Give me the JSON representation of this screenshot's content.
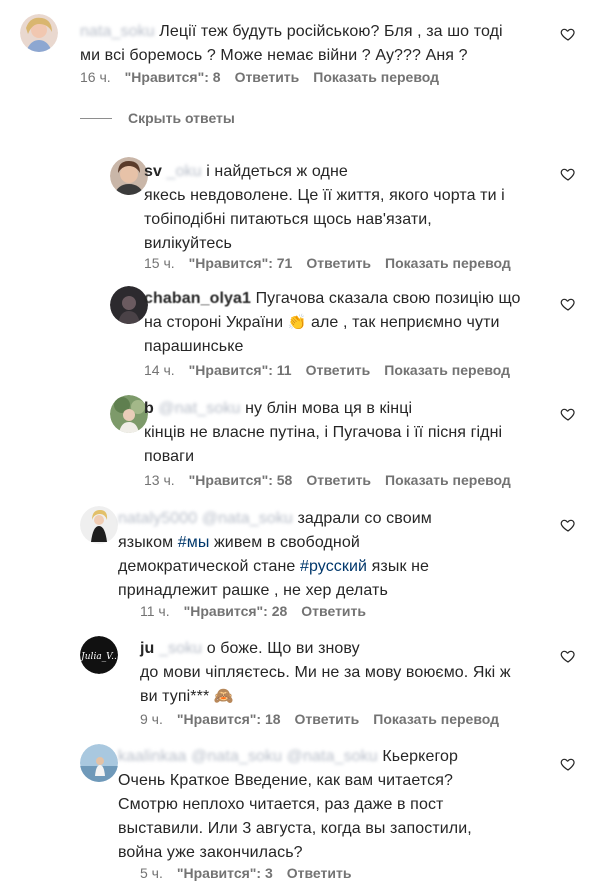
{
  "comments": [
    {
      "user_visible": "",
      "user_blurred": "nata_soku",
      "line1": "Леції теж будуть російською? Бля , за шо тоді",
      "line2": "ми всі боремось ? Може немає війни ? Ау??? Аня ?",
      "time": "16 ч.",
      "likes": "\"Нравится\": 8",
      "reply": "Ответить",
      "translate": "Показать перевод"
    },
    {
      "user_visible": "sv",
      "user_blurred": "_oku",
      "line1": "і найдеться ж одне",
      "line2": "якесь невдоволене. Це її життя, якого чорта ти і",
      "line3": "тобіподібні питаються щось нав'язати,",
      "line4": "вилікуйтесь",
      "time": "15 ч.",
      "likes": "\"Нравится\": 71",
      "reply": "Ответить",
      "translate": "Показать перевод"
    },
    {
      "user_visible": "chaban_olya1",
      "line1": "Пугачова сказала свою позицію що",
      "line2a": "на стороні України",
      "line2b": "але , так неприємно чути",
      "line3": "парашинське",
      "time": "14 ч.",
      "likes": "\"Нравится\": 11",
      "reply": "Ответить",
      "translate": "Показать перевод"
    },
    {
      "user_visible": "b",
      "user_blurred": "@nat_soku",
      "line1": "ну блін мова ця в кінці",
      "line2": "кінців не власне путіна, і Пугачова і її пісня гідні",
      "line3": "поваги",
      "time": "13 ч.",
      "likes": "\"Нравится\": 58",
      "reply": "Ответить",
      "translate": "Показать перевод"
    },
    {
      "user_visible": "nataly5000",
      "user_blurred": "@nata_soku",
      "line1": "задрали со своим",
      "line2a": "языком",
      "tag1": "#мы",
      "line2b": "живем в свободной",
      "line3": "демократической стане",
      "tag2": "#русский",
      "line3b": "язык не",
      "line4": "принадлежит рашке , не хер делать",
      "time": "11 ч.",
      "likes": "\"Нравится\": 28",
      "reply": "Ответить"
    },
    {
      "user_visible": "ju",
      "user_blurred": "_soku",
      "line1": "о боже. Що ви знову",
      "line2": "до мови чіпляєтесь. Ми не за мову воюємо. Які ж",
      "line3": "ви тупі***",
      "avatar_text": "Julia_V..",
      "time": "9 ч.",
      "likes": "\"Нравится\": 18",
      "reply": "Ответить",
      "translate": "Показать перевод"
    },
    {
      "user_visible": "kaalinkaa",
      "user_blurred": "@nata_soku @nata_soku",
      "line1": "Кьеркегор",
      "line2": "Очень Краткое Введение, как вам читается?",
      "line3": "Смотрю неплохо читается, раз даже в пост",
      "line4": "выставили. Или 3 августа, когда вы запостили,",
      "line5": "война уже закончилась?",
      "time": "5 ч.",
      "likes": "\"Нравится\": 3",
      "reply": "Ответить"
    }
  ],
  "hide_replies": "Скрыть ответы",
  "emoji_clap": "👏",
  "emoji_monkey": "🙈",
  "icons": {
    "heart": "heart-outline-icon"
  },
  "colors": {
    "text": "#262626",
    "meta": "#737373",
    "link": "#00376b"
  }
}
